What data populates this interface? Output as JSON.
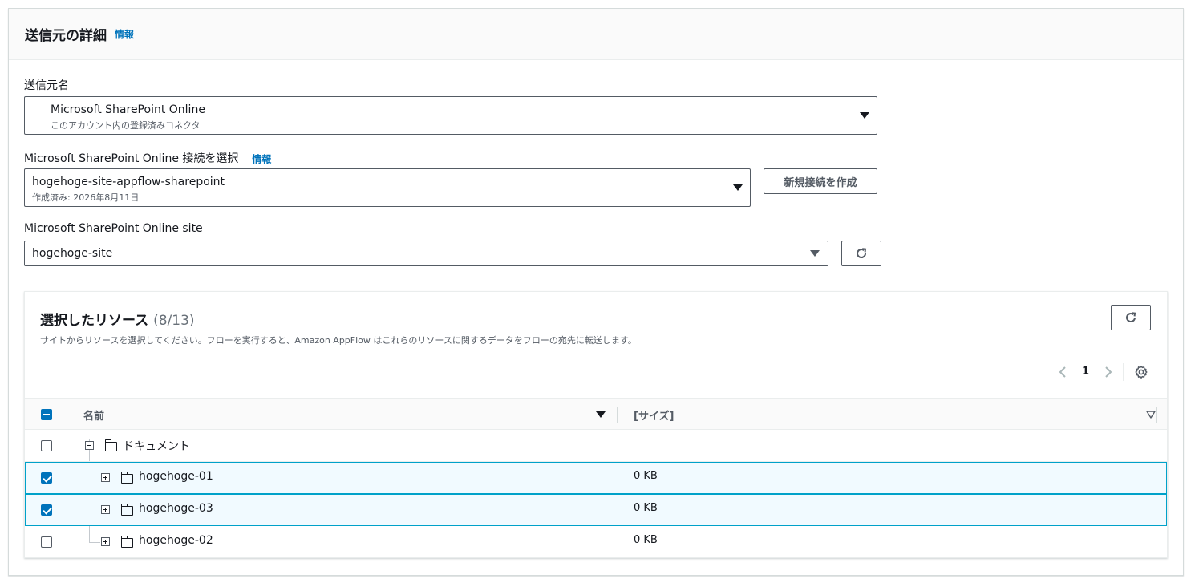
{
  "header": {
    "title": "送信元の詳細",
    "info": "情報"
  },
  "source": {
    "label": "送信元名",
    "value": "Microsoft SharePoint Online",
    "sub": "このアカウント内の登録済みコネクタ"
  },
  "connection": {
    "label": "Microsoft SharePoint Online 接続を選択",
    "info": "情報",
    "value": "hogehoge-site-appflow-sharepoint",
    "sub": "作成済み: 2026年8月11日",
    "create_button": "新規接続を作成"
  },
  "site": {
    "label": "Microsoft SharePoint Online site",
    "value": "hogehoge-site"
  },
  "resources": {
    "title": "選択したリソース",
    "count": "(8/13)",
    "description": "サイトからリソースを選択してください。フローを実行すると、Amazon AppFlow はこれらのリソースに関するデータをフローの宛先に転送します。",
    "page": "1",
    "columns": {
      "name": "名前",
      "size": "[サイズ]"
    },
    "rows": [
      {
        "name": "ドキュメント",
        "size": "",
        "checked": false
      },
      {
        "name": "hogehoge-01",
        "size": "0 KB",
        "checked": true
      },
      {
        "name": "hogehoge-03",
        "size": "0 KB",
        "checked": true
      },
      {
        "name": "hogehoge-02",
        "size": "0 KB",
        "checked": false
      }
    ]
  },
  "icons": [
    "caret-down-icon",
    "refresh-icon",
    "chevron-left-icon",
    "chevron-right-icon",
    "gear-icon",
    "folder-icon",
    "expand-icon",
    "collapse-icon",
    "filter-icon"
  ],
  "colors": {
    "link": "#0073bb",
    "selected_bg": "#f1faff",
    "selected_border": "#00a1c9"
  }
}
